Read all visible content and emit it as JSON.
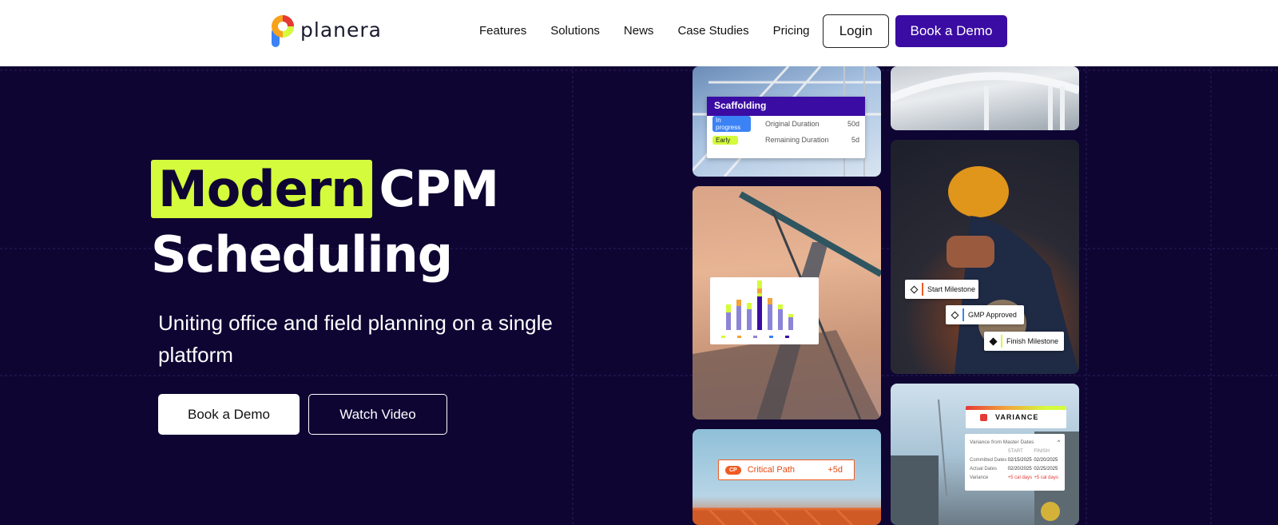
{
  "brand": {
    "name": "planera"
  },
  "nav": {
    "items": [
      "Features",
      "Solutions",
      "News",
      "Case Studies",
      "Pricing"
    ],
    "login_label": "Login",
    "demo_label": "Book a Demo"
  },
  "hero": {
    "title_highlight": "Modern",
    "title_rest": "CPM",
    "title_line2": "Scheduling",
    "subtitle": "Uniting office and field planning on a single platform",
    "demo_button": "Book a Demo",
    "video_button": "Watch Video"
  },
  "cards": {
    "scaffolding": {
      "title": "Scaffolding",
      "status_1": "In progress",
      "status_2": "Early",
      "original_label": "Original Duration",
      "original_value": "50d",
      "remaining_label": "Remaining Duration",
      "remaining_value": "5d"
    },
    "milestones": {
      "start": "Start Milestone",
      "gmp": "GMP Approved",
      "finish": "Finish Milestone"
    },
    "critical_path": {
      "badge": "CP",
      "label": "Critical Path",
      "value": "+5d"
    },
    "variance": {
      "title": "VARIANCE",
      "subtitle": "Variance from Master Dates",
      "col_start": "START",
      "col_finish": "FINISH",
      "rows": [
        {
          "label": "Committed Dates",
          "start": "02/15/2025",
          "finish": "02/20/2025"
        },
        {
          "label": "Actual Dates",
          "start": "02/20/2025",
          "finish": "02/25/2025"
        },
        {
          "label": "Variance",
          "start": "+5 cal days",
          "finish": "+5 cal days"
        }
      ]
    }
  },
  "colors": {
    "hero_bg": "#0e0533",
    "brand_purple": "#3a0ca3",
    "highlight_lime": "#d4fb3c",
    "accent_orange": "#f05a22"
  }
}
